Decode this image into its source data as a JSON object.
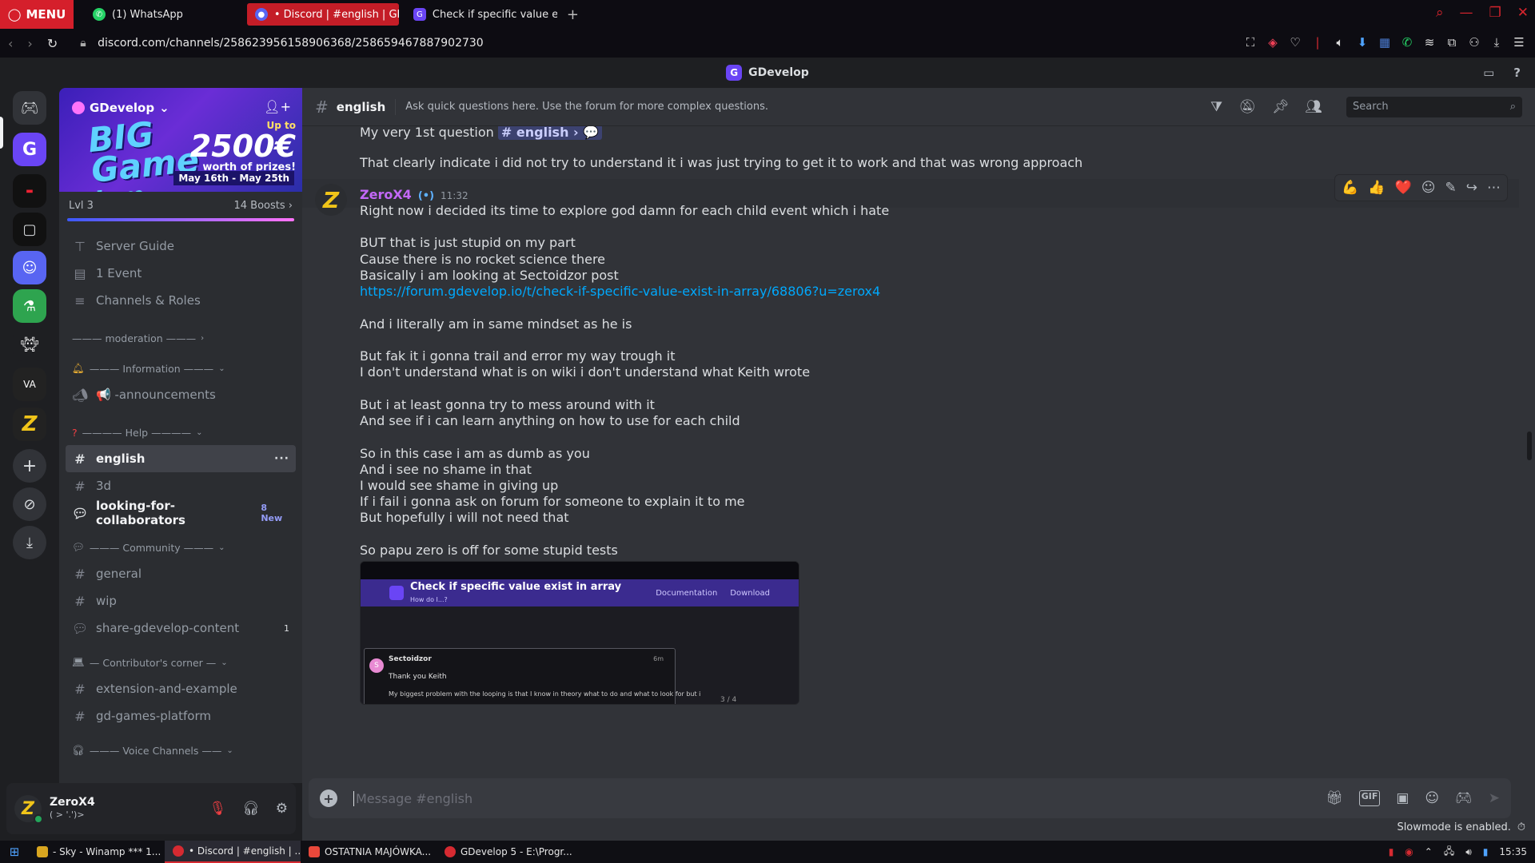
{
  "browser": {
    "menu_label": "MENU",
    "tabs": [
      {
        "label": "(1) WhatsApp",
        "icon": "whatsapp-icon",
        "color": "#25d366"
      },
      {
        "label": "• Discord | #english | GD",
        "icon": "discord-icon",
        "color": "#5865f2"
      },
      {
        "label": "Check if specific value ex",
        "icon": "gdevelop-icon",
        "color": "#6a45f5"
      }
    ],
    "url": "discord.com/channels/258623956158906368/258659467887902730"
  },
  "app": {
    "title": "GDevelop"
  },
  "server": {
    "name": "GDevelop",
    "banner": {
      "line1": "BIG",
      "line2": "Game",
      "line3": "Jam",
      "upto": "Up to",
      "amount": "2500€",
      "worth": "worth of prizes!",
      "dates": "May 16th - May 25th"
    },
    "level": "Lvl 3",
    "boosts": "14 Boosts"
  },
  "sidebar": {
    "top_items": [
      {
        "label": "Server Guide",
        "icon": "signpost-icon"
      },
      {
        "label": "1 Event",
        "icon": "calendar-icon"
      },
      {
        "label": "Channels & Roles",
        "icon": "list-icon"
      }
    ],
    "cat_moderation": "——— moderation ——— ",
    "cat_information": "——— Information ———",
    "announcements": "📢 -announcements",
    "cat_help": "———— Help ————",
    "english": "english",
    "three_d": "3d",
    "collab": "looking-for-collaborators",
    "collab_new": "8 New",
    "cat_community": "——— Community ———",
    "general": "general",
    "wip": "wip",
    "share": "share-gdevelop-content",
    "share_count": "1",
    "cat_contrib": "— Contributor's corner —",
    "extension": "extension-and-example",
    "gdgames": "gd-games-platform",
    "cat_voice": "——— Voice Channels ——"
  },
  "user": {
    "name": "ZeroX4",
    "status": "( > '.')>"
  },
  "channel": {
    "name": "english",
    "topic": "Ask quick questions here. Use the forum for more complex questions.",
    "search_placeholder": "Search"
  },
  "messages": {
    "prev1_prefix": "My very 1st question",
    "prev1_mention": "# english › 💬",
    "prev2": "That clearly indicate i did not try to understand it i was just trying to get it to work and that was wrong approach",
    "author": "ZeroX4",
    "author_tag": "(•)",
    "time": "11:32",
    "lines": [
      "Right now i decided its time to explore god damn for each child event which i hate",
      "BUT that is just stupid on my part",
      "Cause there is no rocket science there",
      "Basically i am looking at Sectoidzor post",
      "https://forum.gdevelop.io/t/check-if-specific-value-exist-in-array/68806?u=zerox4",
      "And i literally am in same mindset as he is",
      "But fak it i gonna trail and error my way trough it",
      "I don't understand what is on wiki i don't understand what Keith wrote",
      "But i at least gonna try to mess around with it",
      "And see if i can learn anything on how to use for each child",
      "So in this case i am as dumb as you",
      "And i see no shame in that",
      "I would see shame in giving up",
      "If i fail i gonna ask on forum for someone to explain it to me",
      "But hopefully i will not need that",
      "So papu zero is off for some stupid tests"
    ],
    "attachment": {
      "title": "Check if specific value exist in array",
      "subtitle": "How do I...?",
      "nav1": "Documentation",
      "nav2": "Download",
      "poster": "Sectoidzor",
      "thanks": "Thank you Keith",
      "body": "My biggest problem with the looping is that I know in theory what to do and what to look for but i",
      "pager": "3 / 4",
      "time": "6m"
    }
  },
  "composer": {
    "placeholder": "Message #english",
    "slowmode": "Slowmode is enabled."
  },
  "taskbar": {
    "items": [
      {
        "label": "- Sky - Winamp *** 1...",
        "color": "#d9a620"
      },
      {
        "label": "• Discord | #english | ...",
        "color": "#d62a31"
      },
      {
        "label": "OSTATNIA MAJÓWKA...",
        "color": "#e8483b"
      },
      {
        "label": "GDevelop 5 - E:\\Progr...",
        "color": "#d62a31"
      }
    ],
    "clock": "15:35"
  }
}
